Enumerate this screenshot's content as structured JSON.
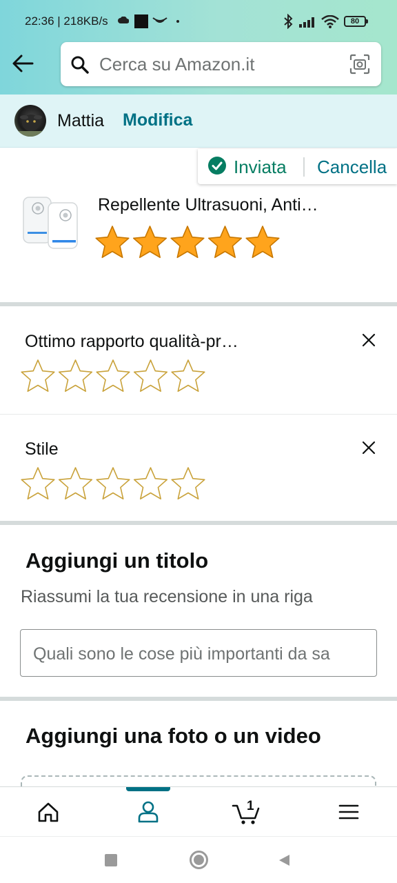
{
  "status_bar": {
    "time_speed": "22:36 | 218KB/s",
    "battery": "80"
  },
  "search": {
    "placeholder": "Cerca su Amazon.it"
  },
  "account": {
    "name": "Mattia",
    "edit_label": "Modifica"
  },
  "review_status": {
    "sent_label": "Inviata",
    "cancel_label": "Cancella"
  },
  "product": {
    "title": "Repellente Ultrasuoni, Anti…",
    "rating": 5,
    "rating_max": 5
  },
  "attributes": [
    {
      "label": "Ottimo rapporto qualità-pr…",
      "rating": 0,
      "rating_max": 5
    },
    {
      "label": "Stile",
      "rating": 0,
      "rating_max": 5
    }
  ],
  "title_section": {
    "heading": "Aggiungi un titolo",
    "subheading": "Riassumi la tua recensione in una riga",
    "input_placeholder": "Quali sono le cose più importanti da sa"
  },
  "media_section": {
    "heading": "Aggiungi una foto o un video"
  },
  "bottom_nav": {
    "items": [
      "home-icon",
      "account-icon",
      "cart-icon",
      "menu-icon"
    ],
    "active": "account-icon",
    "cart_count": "1"
  },
  "colors": {
    "accent_teal": "#007185",
    "success_green": "#067d62",
    "star_gold": "#ffa41c",
    "star_outline": "#c9a23a"
  }
}
